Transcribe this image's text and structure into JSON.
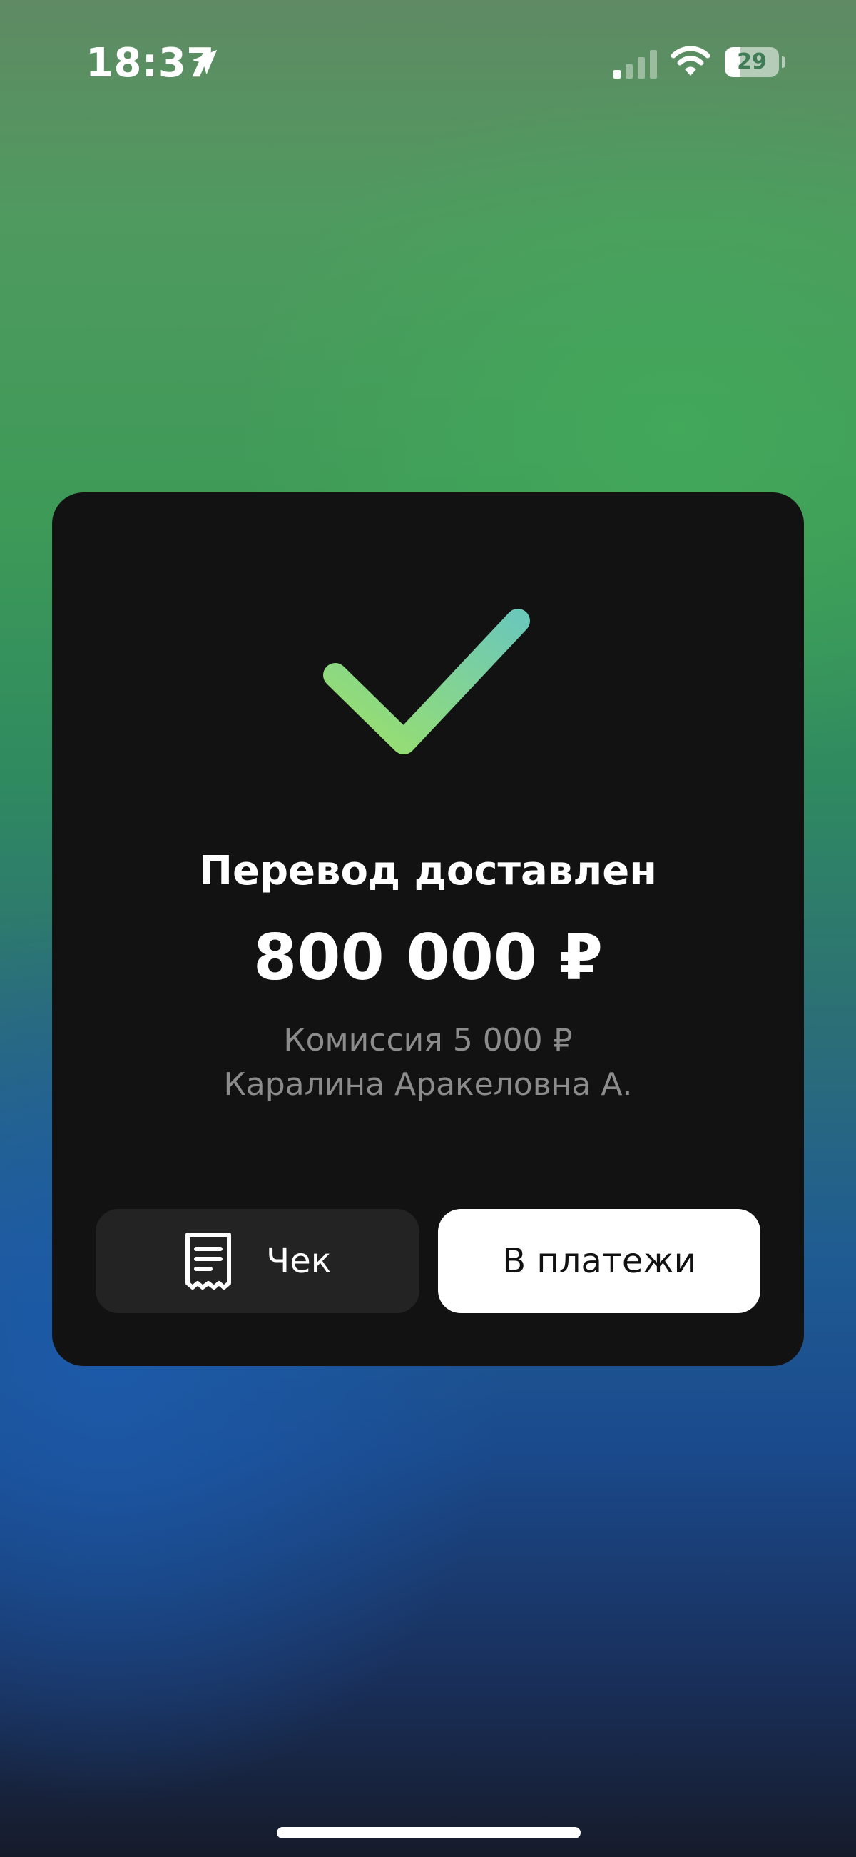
{
  "status_bar": {
    "time": "18:37",
    "battery_level": "29",
    "battery_fraction": 0.29,
    "signal_bars_active": 1,
    "signal_bars_total": 4
  },
  "result": {
    "icon": "checkmark-icon",
    "title": "Перевод доставлен",
    "amount": "800 000 ₽",
    "commission": "Комиссия 5 000 ₽",
    "recipient": "Каралина Аракеловна А."
  },
  "actions": {
    "receipt_label": "Чек",
    "receipt_icon": "receipt-icon",
    "payments_label": "В платежи"
  },
  "colors": {
    "card_bg": "#121212",
    "check_gradient_start": "#9be06a",
    "check_gradient_end": "#6cc8b8",
    "secondary_text": "#8c8c8c"
  }
}
